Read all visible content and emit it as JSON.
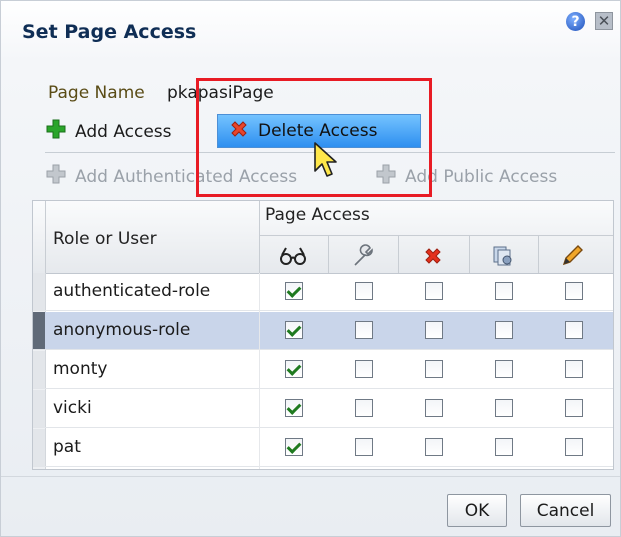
{
  "dialog": {
    "title": "Set Page Access",
    "help_icon": "help-icon",
    "close_icon": "close-icon"
  },
  "page": {
    "name_label": "Page Name",
    "name_value": "pkapasiPage"
  },
  "toolbar": {
    "add_access_label": "Add Access",
    "delete_access_label": "Delete Access",
    "add_authenticated_label": "Add Authenticated Access",
    "add_public_label": "Add Public Access"
  },
  "table": {
    "role_header": "Role or User",
    "group_header": "Page Access",
    "columns": [
      {
        "icon": "view-icon"
      },
      {
        "icon": "customize-icon"
      },
      {
        "icon": "delete-icon"
      },
      {
        "icon": "personalize-icon"
      },
      {
        "icon": "edit-icon"
      }
    ],
    "rows": [
      {
        "name": "authenticated-role",
        "perms": [
          true,
          false,
          false,
          false,
          false
        ],
        "selected": false
      },
      {
        "name": "anonymous-role",
        "perms": [
          true,
          false,
          false,
          false,
          false
        ],
        "selected": true
      },
      {
        "name": "monty",
        "perms": [
          true,
          false,
          false,
          false,
          false
        ],
        "selected": false
      },
      {
        "name": "vicki",
        "perms": [
          true,
          false,
          false,
          false,
          false
        ],
        "selected": false
      },
      {
        "name": "pat",
        "perms": [
          true,
          false,
          false,
          false,
          false
        ],
        "selected": false
      }
    ]
  },
  "buttons": {
    "ok": "OK",
    "cancel": "Cancel"
  },
  "colors": {
    "highlight_box": "#e81b24",
    "selected_row": "#c9d5ea",
    "title": "#0f2e55"
  }
}
